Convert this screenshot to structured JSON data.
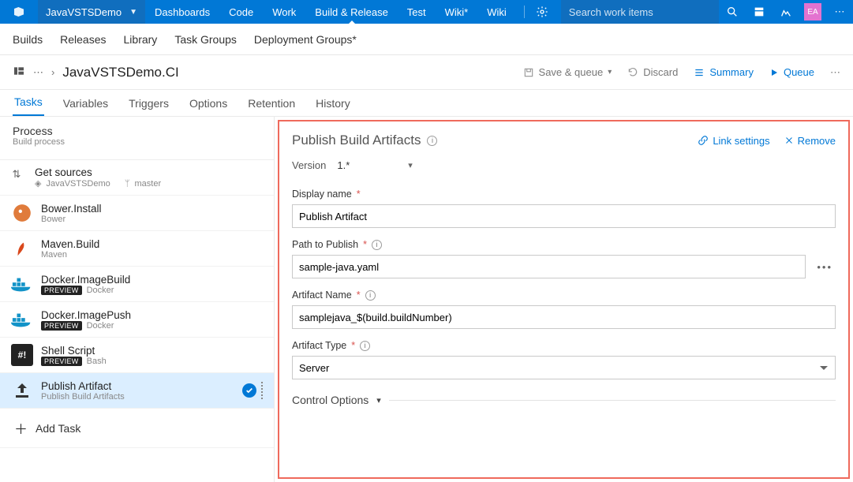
{
  "topbar": {
    "project": "JavaVSTSDemo",
    "nav": [
      "Dashboards",
      "Code",
      "Work",
      "Build & Release",
      "Test",
      "Wiki*",
      "Wiki"
    ],
    "activeNavIndex": 3,
    "searchPlaceholder": "Search work items",
    "avatar": "EA"
  },
  "subnav": [
    "Builds",
    "Releases",
    "Library",
    "Task Groups",
    "Deployment Groups*"
  ],
  "breadcrumb": {
    "title": "JavaVSTSDemo.CI"
  },
  "toolbar": {
    "saveQueue": "Save & queue",
    "discard": "Discard",
    "summary": "Summary",
    "queue": "Queue"
  },
  "tabs": [
    "Tasks",
    "Variables",
    "Triggers",
    "Options",
    "Retention",
    "History"
  ],
  "activeTabIndex": 0,
  "process": {
    "title": "Process",
    "subtitle": "Build process"
  },
  "getSources": {
    "label": "Get sources",
    "repo": "JavaVSTSDemo",
    "branch": "master"
  },
  "tasks": [
    {
      "name": "Bower.Install",
      "meta": "Bower",
      "iconBg": "#fff",
      "preview": false
    },
    {
      "name": "Maven.Build",
      "meta": "Maven",
      "iconBg": "#fff",
      "preview": false
    },
    {
      "name": "Docker.ImageBuild",
      "meta": "Docker",
      "iconBg": "#fff",
      "preview": true
    },
    {
      "name": "Docker.ImagePush",
      "meta": "Docker",
      "iconBg": "#fff",
      "preview": true
    },
    {
      "name": "Shell Script",
      "meta": "Bash",
      "iconBg": "#222",
      "preview": true
    },
    {
      "name": "Publish Artifact",
      "meta": "Publish Build Artifacts",
      "iconBg": "#fff",
      "preview": false,
      "selected": true
    }
  ],
  "addTask": "Add Task",
  "detail": {
    "title": "Publish Build Artifacts",
    "linkSettings": "Link settings",
    "remove": "Remove",
    "versionLabel": "Version",
    "version": "1.*",
    "displayNameLabel": "Display name",
    "displayName": "Publish Artifact",
    "pathLabel": "Path to Publish",
    "path": "sample-java.yaml",
    "artifactNameLabel": "Artifact Name",
    "artifactName": "samplejava_$(build.buildNumber)",
    "artifactTypeLabel": "Artifact Type",
    "artifactType": "Server",
    "controlOptions": "Control Options"
  }
}
